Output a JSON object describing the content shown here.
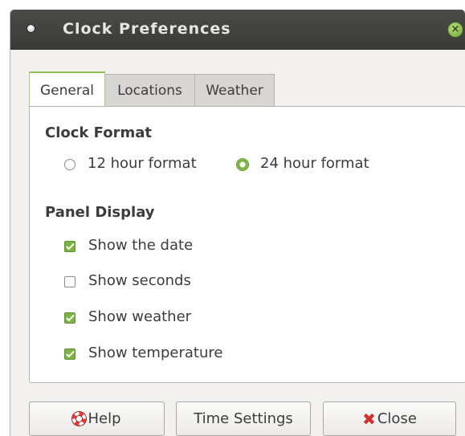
{
  "window": {
    "title": "Clock Preferences"
  },
  "tabs": [
    {
      "label": "General",
      "active": true
    },
    {
      "label": "Locations",
      "active": false
    },
    {
      "label": "Weather",
      "active": false
    }
  ],
  "clock_format": {
    "heading": "Clock Format",
    "options": [
      {
        "label": "12 hour format",
        "selected": false
      },
      {
        "label": "24 hour format",
        "selected": true
      }
    ]
  },
  "panel_display": {
    "heading": "Panel Display",
    "items": [
      {
        "label": "Show the date",
        "checked": true
      },
      {
        "label": "Show seconds",
        "checked": false
      },
      {
        "label": "Show weather",
        "checked": true
      },
      {
        "label": "Show temperature",
        "checked": true
      }
    ]
  },
  "buttons": {
    "help": "Help",
    "time_settings": "Time Settings",
    "close": "Close"
  },
  "icons": {
    "window_menu": "window-menu-icon",
    "window_close": "window-close-icon",
    "help": "lifebuoy-icon",
    "close": "red-x-icon"
  },
  "colors": {
    "accent": "#7cb342",
    "titlebar": "#3f3f3b",
    "close_red": "#d32f2f"
  }
}
